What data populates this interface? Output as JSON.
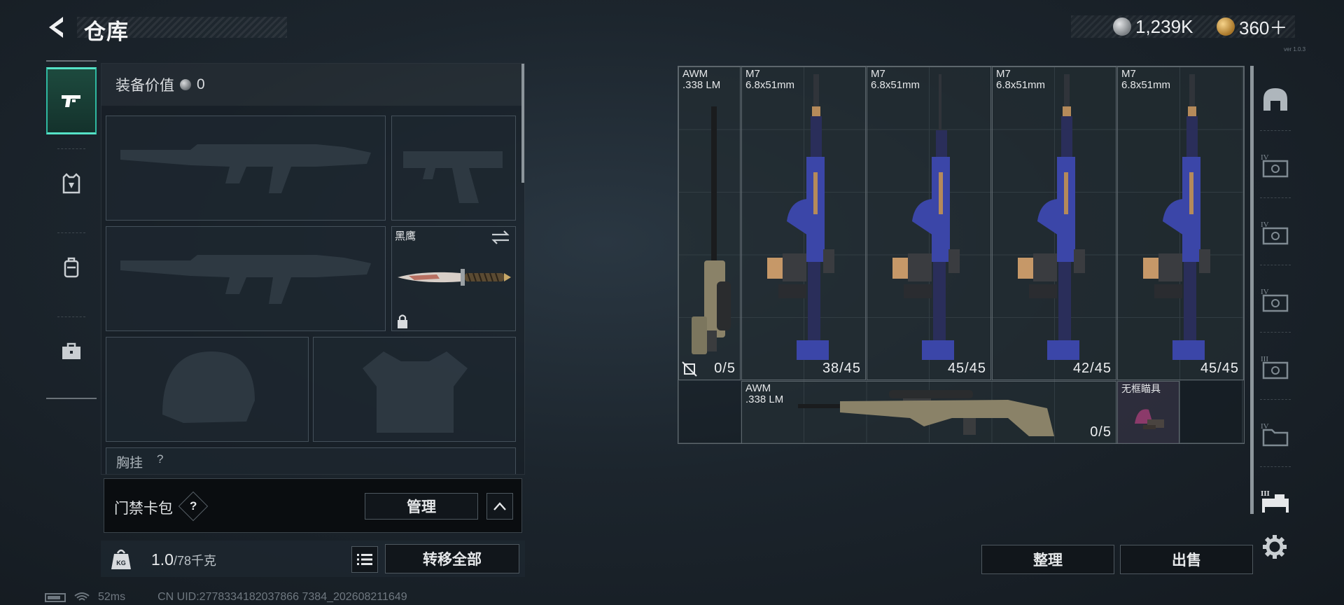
{
  "header": {
    "title": "仓库",
    "currency": {
      "silver": "1,239K",
      "gold": "360＋"
    },
    "version": "ver 1.0.3"
  },
  "left_tabs": [
    {
      "name": "weapons",
      "icon": "pistol-icon",
      "active": true
    },
    {
      "name": "armor",
      "icon": "vest-icon",
      "active": false
    },
    {
      "name": "backpack",
      "icon": "backpack-icon",
      "active": false
    },
    {
      "name": "case",
      "icon": "briefcase-icon",
      "active": false
    }
  ],
  "loadout": {
    "equip_value_label": "装备价值",
    "equip_value": "0",
    "knife_name": "黑鹰",
    "chest_label": "胸挂",
    "chest_help": "?"
  },
  "access_card": {
    "label": "门禁卡包",
    "help": "?",
    "manage_label": "管理"
  },
  "weight": {
    "current": "1.0",
    "max": "/78千克",
    "icon_text": "KG",
    "transfer_all_label": "转移全部"
  },
  "status": {
    "ping": "52ms",
    "uid": "CN UID:2778334182037866 7384_202608211649"
  },
  "warehouse": {
    "items": [
      {
        "name": "AWM",
        "caliber": ".338 LM",
        "ammo": "0/5"
      },
      {
        "name": "M7",
        "caliber": "6.8x51mm",
        "ammo": "38/45"
      },
      {
        "name": "M7",
        "caliber": "6.8x51mm",
        "ammo": "45/45"
      },
      {
        "name": "M7",
        "caliber": "6.8x51mm",
        "ammo": "42/45"
      },
      {
        "name": "M7",
        "caliber": "6.8x51mm",
        "ammo": "45/45"
      },
      {
        "name": "AWM",
        "caliber": ".338 LM",
        "ammo": "0/5"
      },
      {
        "name": "无框瞄具"
      }
    ]
  },
  "actions": {
    "sort_label": "整理",
    "sell_label": "出售"
  },
  "right_tabs": [
    {
      "icon": "helmet-tab-icon"
    },
    {
      "icon": "case-tier4-icon",
      "tier": "IV"
    },
    {
      "icon": "case-tier4-icon",
      "tier": "IV"
    },
    {
      "icon": "case-tier4-icon",
      "tier": "IV"
    },
    {
      "icon": "case-tier3-icon",
      "tier": "III"
    },
    {
      "icon": "folder-tier4-icon",
      "tier": "IV"
    },
    {
      "icon": "bed-tier3-icon",
      "tier": "III"
    }
  ],
  "colors": {
    "accent": "#2fb8a0",
    "panel": "#1c252d",
    "gun_blue": "#3b46a8",
    "gun_bronze": "#b58a5a"
  }
}
